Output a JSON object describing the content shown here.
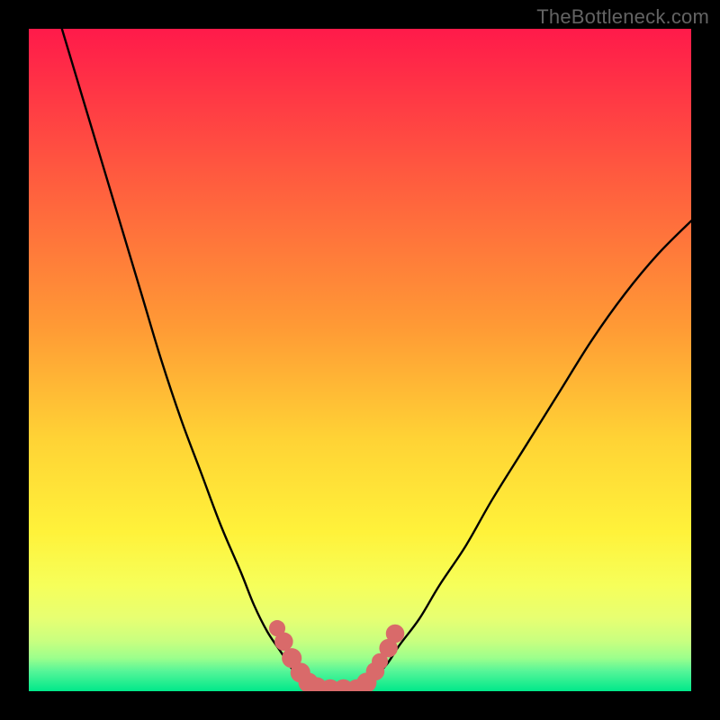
{
  "watermark": "TheBottleneck.com",
  "chart_data": {
    "type": "line",
    "title": "",
    "xlabel": "",
    "ylabel": "",
    "xlim": [
      0,
      100
    ],
    "ylim": [
      0,
      100
    ],
    "grid": false,
    "legend": false,
    "background_gradient": {
      "top": "#ff1a4a",
      "mid_upper": "#ff7a3a",
      "mid": "#ffe03a",
      "mid_lower": "#f7ff60",
      "green_band": "#c8ff80",
      "bottom": "#00e88a"
    },
    "series": [
      {
        "name": "left-curve",
        "color": "#000000",
        "x": [
          5,
          8,
          11,
          14,
          17,
          20,
          23,
          26,
          29,
          32,
          34,
          36,
          38,
          40,
          41.5,
          43
        ],
        "y": [
          100,
          90,
          80,
          70,
          60,
          50,
          41,
          33,
          25,
          18,
          13,
          9,
          6,
          3,
          1.5,
          0.5
        ]
      },
      {
        "name": "right-curve",
        "color": "#000000",
        "x": [
          50,
          52,
          54,
          56,
          59,
          62,
          66,
          70,
          75,
          80,
          85,
          90,
          95,
          100
        ],
        "y": [
          0.5,
          2,
          4,
          7,
          11,
          16,
          22,
          29,
          37,
          45,
          53,
          60,
          66,
          71
        ]
      },
      {
        "name": "bottom-flat",
        "color": "#000000",
        "x": [
          43,
          50
        ],
        "y": [
          0.3,
          0.3
        ]
      }
    ],
    "markers": {
      "name": "dots-near-minimum",
      "color": "#d96a6a",
      "points": [
        {
          "x": 37.5,
          "y": 9.5,
          "r": 1.0
        },
        {
          "x": 38.5,
          "y": 7.5,
          "r": 1.3
        },
        {
          "x": 39.7,
          "y": 5.0,
          "r": 1.5
        },
        {
          "x": 41.0,
          "y": 2.8,
          "r": 1.5
        },
        {
          "x": 42.2,
          "y": 1.3,
          "r": 1.5
        },
        {
          "x": 43.5,
          "y": 0.6,
          "r": 1.5
        },
        {
          "x": 45.5,
          "y": 0.3,
          "r": 1.5
        },
        {
          "x": 47.5,
          "y": 0.3,
          "r": 1.5
        },
        {
          "x": 49.5,
          "y": 0.3,
          "r": 1.5
        },
        {
          "x": 51.0,
          "y": 1.3,
          "r": 1.5
        },
        {
          "x": 52.3,
          "y": 3.0,
          "r": 1.3
        },
        {
          "x": 53.0,
          "y": 4.5,
          "r": 1.0
        },
        {
          "x": 54.3,
          "y": 6.5,
          "r": 1.3
        },
        {
          "x": 55.3,
          "y": 8.7,
          "r": 1.3
        }
      ]
    }
  }
}
